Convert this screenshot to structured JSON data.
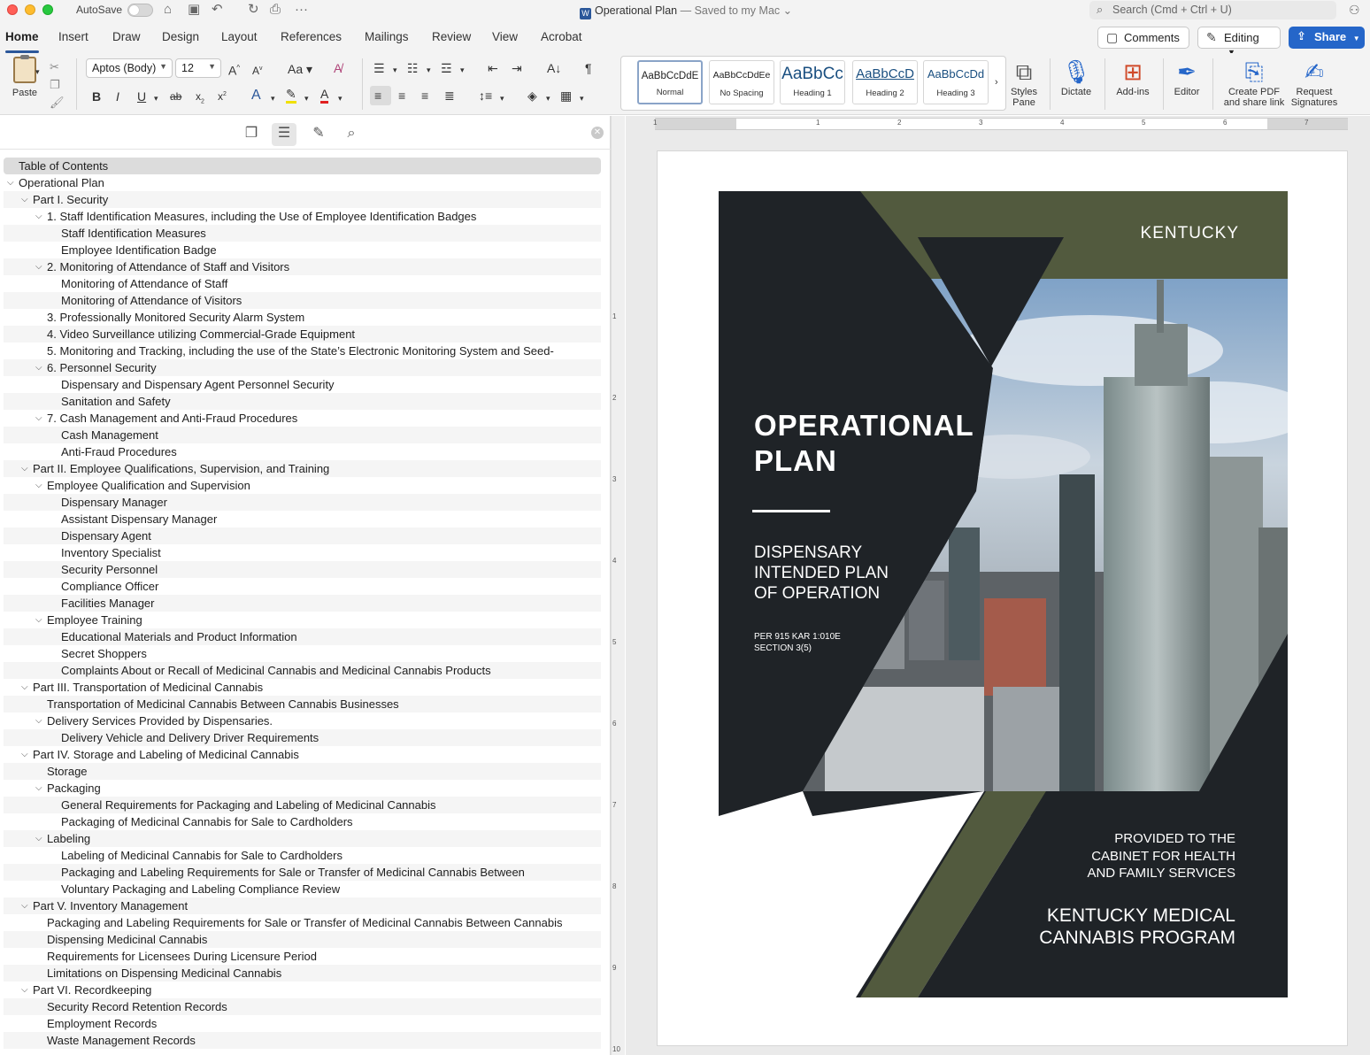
{
  "titlebar": {
    "autosave_label": "AutoSave",
    "doc_title": "Operational Plan",
    "doc_status": "— Saved to my Mac",
    "search_placeholder": "Search (Cmd + Ctrl + U)"
  },
  "tabs": [
    "Home",
    "Insert",
    "Draw",
    "Design",
    "Layout",
    "References",
    "Mailings",
    "Review",
    "View",
    "Acrobat"
  ],
  "tab_actions": {
    "comments": "Comments",
    "editing": "Editing",
    "share": "Share"
  },
  "ribbon": {
    "paste": "Paste",
    "font_name": "Aptos (Body)",
    "font_size": "12",
    "styles": [
      {
        "sample": "AaBbCcDdE",
        "name": "Normal"
      },
      {
        "sample": "AaBbCcDdEe",
        "name": "No Spacing"
      },
      {
        "sample": "AaBbCc",
        "name": "Heading 1"
      },
      {
        "sample": "AaBbCcD",
        "name": "Heading 2"
      },
      {
        "sample": "AaBbCcDd",
        "name": "Heading 3"
      }
    ],
    "styles_pane": [
      "Styles",
      "Pane"
    ],
    "dictate": "Dictate",
    "addins": "Add-ins",
    "editor": "Editor",
    "create_pdf": [
      "Create PDF",
      "and share link"
    ],
    "request_sig": [
      "Request",
      "Signatures"
    ]
  },
  "nav": {
    "header": "Table of Contents",
    "items": [
      {
        "level": 0,
        "chev": true,
        "text": "Operational Plan"
      },
      {
        "level": 1,
        "chev": true,
        "text": "Part I. Security"
      },
      {
        "level": 2,
        "chev": true,
        "text": "1. Staff Identification Measures, including the Use of Employee Identification Badges"
      },
      {
        "level": 3,
        "chev": false,
        "text": "Staff Identification Measures"
      },
      {
        "level": 3,
        "chev": false,
        "text": "Employee Identification Badge"
      },
      {
        "level": 2,
        "chev": true,
        "text": "2. Monitoring of Attendance of Staff and Visitors"
      },
      {
        "level": 3,
        "chev": false,
        "text": "Monitoring of Attendance of Staff"
      },
      {
        "level": 3,
        "chev": false,
        "text": "Monitoring of Attendance of Visitors"
      },
      {
        "level": 2,
        "chev": false,
        "text": "3. Professionally Monitored Security Alarm System"
      },
      {
        "level": 2,
        "chev": false,
        "text": "4. Video Surveillance utilizing Commercial-Grade Equipment"
      },
      {
        "level": 2,
        "chev": false,
        "text": "5. Monitoring and Tracking, including the use of the State’s Electronic Monitoring System and Seed-"
      },
      {
        "level": 2,
        "chev": true,
        "text": "6. Personnel Security"
      },
      {
        "level": 3,
        "chev": false,
        "text": "Dispensary and Dispensary Agent Personnel Security"
      },
      {
        "level": 3,
        "chev": false,
        "text": "Sanitation and Safety"
      },
      {
        "level": 2,
        "chev": true,
        "text": "7. Cash Management and Anti-Fraud Procedures"
      },
      {
        "level": 3,
        "chev": false,
        "text": "Cash Management"
      },
      {
        "level": 3,
        "chev": false,
        "text": "Anti-Fraud Procedures"
      },
      {
        "level": 1,
        "chev": true,
        "text": "Part II. Employee Qualifications, Supervision, and Training"
      },
      {
        "level": 2,
        "chev": true,
        "text": "Employee Qualification and Supervision"
      },
      {
        "level": 3,
        "chev": false,
        "text": "Dispensary Manager"
      },
      {
        "level": 3,
        "chev": false,
        "text": "Assistant Dispensary Manager"
      },
      {
        "level": 3,
        "chev": false,
        "text": "Dispensary Agent"
      },
      {
        "level": 3,
        "chev": false,
        "text": "Inventory Specialist"
      },
      {
        "level": 3,
        "chev": false,
        "text": "Security Personnel"
      },
      {
        "level": 3,
        "chev": false,
        "text": "Compliance Officer"
      },
      {
        "level": 3,
        "chev": false,
        "text": "Facilities Manager"
      },
      {
        "level": 2,
        "chev": true,
        "text": "Employee Training"
      },
      {
        "level": 3,
        "chev": false,
        "text": "Educational Materials and Product Information"
      },
      {
        "level": 3,
        "chev": false,
        "text": "Secret Shoppers"
      },
      {
        "level": 3,
        "chev": false,
        "text": "Complaints About or Recall of Medicinal Cannabis and Medicinal Cannabis Products"
      },
      {
        "level": 1,
        "chev": true,
        "text": "Part III. Transportation of Medicinal Cannabis"
      },
      {
        "level": 2,
        "chev": false,
        "text": "Transportation of Medicinal Cannabis Between Cannabis Businesses"
      },
      {
        "level": 2,
        "chev": true,
        "text": "Delivery Services Provided by Dispensaries."
      },
      {
        "level": 3,
        "chev": false,
        "text": "Delivery Vehicle and Delivery Driver Requirements"
      },
      {
        "level": 1,
        "chev": true,
        "text": "Part IV. Storage and Labeling of Medicinal Cannabis"
      },
      {
        "level": 2,
        "chev": false,
        "text": "Storage"
      },
      {
        "level": 2,
        "chev": true,
        "text": "Packaging"
      },
      {
        "level": 3,
        "chev": false,
        "text": "General Requirements for Packaging and Labeling of Medicinal Cannabis"
      },
      {
        "level": 3,
        "chev": false,
        "text": "Packaging of Medicinal Cannabis for Sale to Cardholders"
      },
      {
        "level": 2,
        "chev": true,
        "text": "Labeling"
      },
      {
        "level": 3,
        "chev": false,
        "text": "Labeling of Medicinal Cannabis for Sale to Cardholders"
      },
      {
        "level": 3,
        "chev": false,
        "text": "Packaging and Labeling Requirements for Sale or Transfer of Medicinal Cannabis Between"
      },
      {
        "level": 3,
        "chev": false,
        "text": "Voluntary Packaging and Labeling Compliance Review"
      },
      {
        "level": 1,
        "chev": true,
        "text": "Part V. Inventory Management"
      },
      {
        "level": 2,
        "chev": false,
        "text": "Packaging and Labeling Requirements for Sale or Transfer of Medicinal Cannabis Between Cannabis"
      },
      {
        "level": 2,
        "chev": false,
        "text": "Dispensing Medicinal Cannabis"
      },
      {
        "level": 2,
        "chev": false,
        "text": "Requirements for Licensees During Licensure Period"
      },
      {
        "level": 2,
        "chev": false,
        "text": "Limitations on Dispensing Medicinal Cannabis"
      },
      {
        "level": 1,
        "chev": true,
        "text": "Part VI. Recordkeeping"
      },
      {
        "level": 2,
        "chev": false,
        "text": "Security Record Retention Records"
      },
      {
        "level": 2,
        "chev": false,
        "text": "Employment Records"
      },
      {
        "level": 2,
        "chev": false,
        "text": "Waste Management Records"
      }
    ]
  },
  "ruler": {
    "h_numbers": [
      "1",
      "1",
      "2",
      "3",
      "4",
      "5",
      "6",
      "7"
    ],
    "v_numbers": [
      "1",
      "2",
      "3",
      "4",
      "5",
      "6",
      "7",
      "8",
      "9",
      "10"
    ]
  },
  "cover": {
    "state": "KENTUCKY",
    "title": [
      "OPERATIONAL",
      "PLAN"
    ],
    "subtitle": [
      "DISPENSARY",
      "INTENDED PLAN",
      "OF OPERATION"
    ],
    "reference": [
      "PER 915 KAR 1:010E",
      "SECTION 3(5)"
    ],
    "provided": [
      "PROVIDED TO THE",
      "CABINET FOR HEALTH",
      "AND FAMILY SERVICES"
    ],
    "program": [
      "KENTUCKY MEDICAL",
      "CANNABIS PROGRAM"
    ]
  },
  "colors": {
    "accent": "#2b579a",
    "share": "#2566c9",
    "cover_dark": "#1f2327",
    "cover_olive": "#525a3e"
  }
}
